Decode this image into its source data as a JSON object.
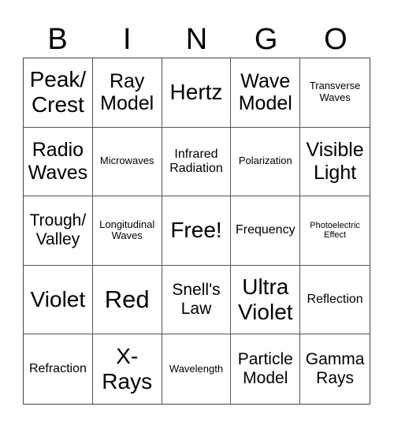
{
  "header": {
    "letters": [
      "B",
      "I",
      "N",
      "G",
      "O"
    ]
  },
  "grid": {
    "rows": [
      [
        "Peak/\nCrest",
        "Ray\nModel",
        "Hertz",
        "Wave\nModel",
        "Transverse\nWaves"
      ],
      [
        "Radio\nWaves",
        "Microwaves",
        "Infrared\nRadiation",
        "Polarization",
        "Visible\nLight"
      ],
      [
        "Trough/\nValley",
        "Longitudinal\nWaves",
        "Free!",
        "Frequency",
        "Photoelectric\nEffect"
      ],
      [
        "Violet",
        "Red",
        "Snell's\nLaw",
        "Ultra\nViolet",
        "Reflection"
      ],
      [
        "Refraction",
        "X-\nRays",
        "Wavelength",
        "Particle\nModel",
        "Gamma\nRays"
      ]
    ]
  },
  "colors": {
    "text": "#000000",
    "border": "#555555",
    "background": "#ffffff"
  }
}
